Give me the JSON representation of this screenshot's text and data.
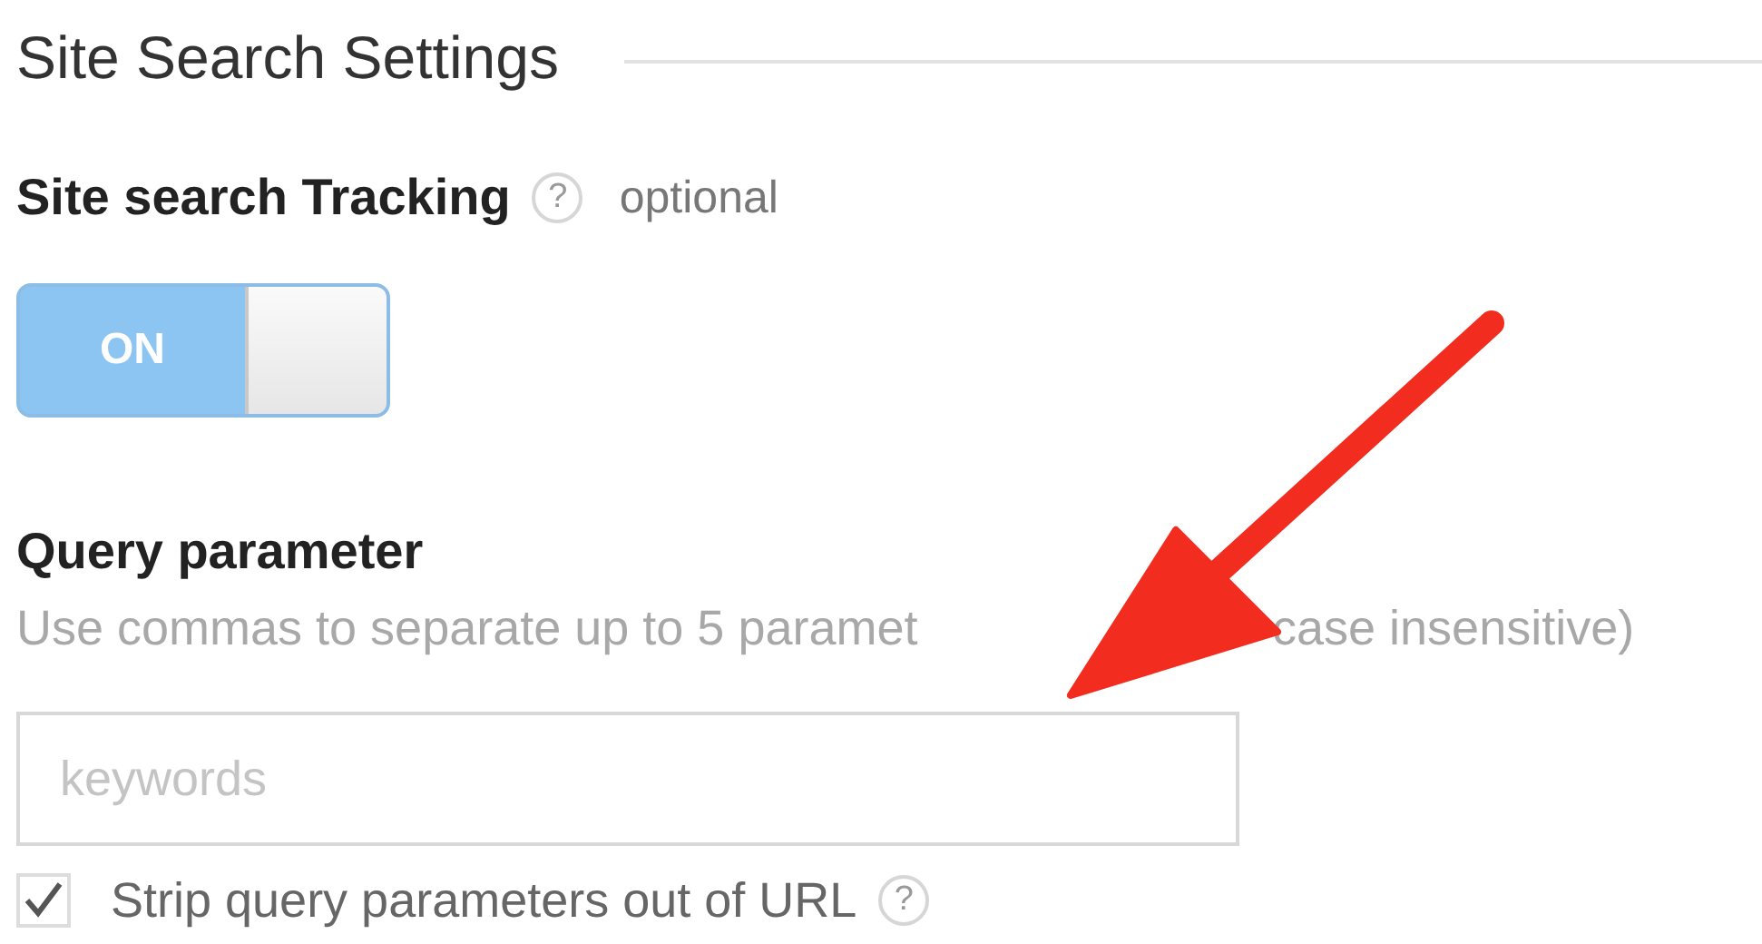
{
  "section": {
    "title": "Site Search Settings"
  },
  "tracking": {
    "label": "Site search Tracking",
    "help": "?",
    "note": "optional",
    "toggle": {
      "label": "ON",
      "on": true
    }
  },
  "query": {
    "label": "Query parameter",
    "hint_parts": [
      "Use commas to separate up to 5 paramet",
      "case insensitive)"
    ],
    "placeholder": "keywords"
  },
  "strip": {
    "label": "Strip query parameters out of URL",
    "help": "?",
    "checked": true
  }
}
